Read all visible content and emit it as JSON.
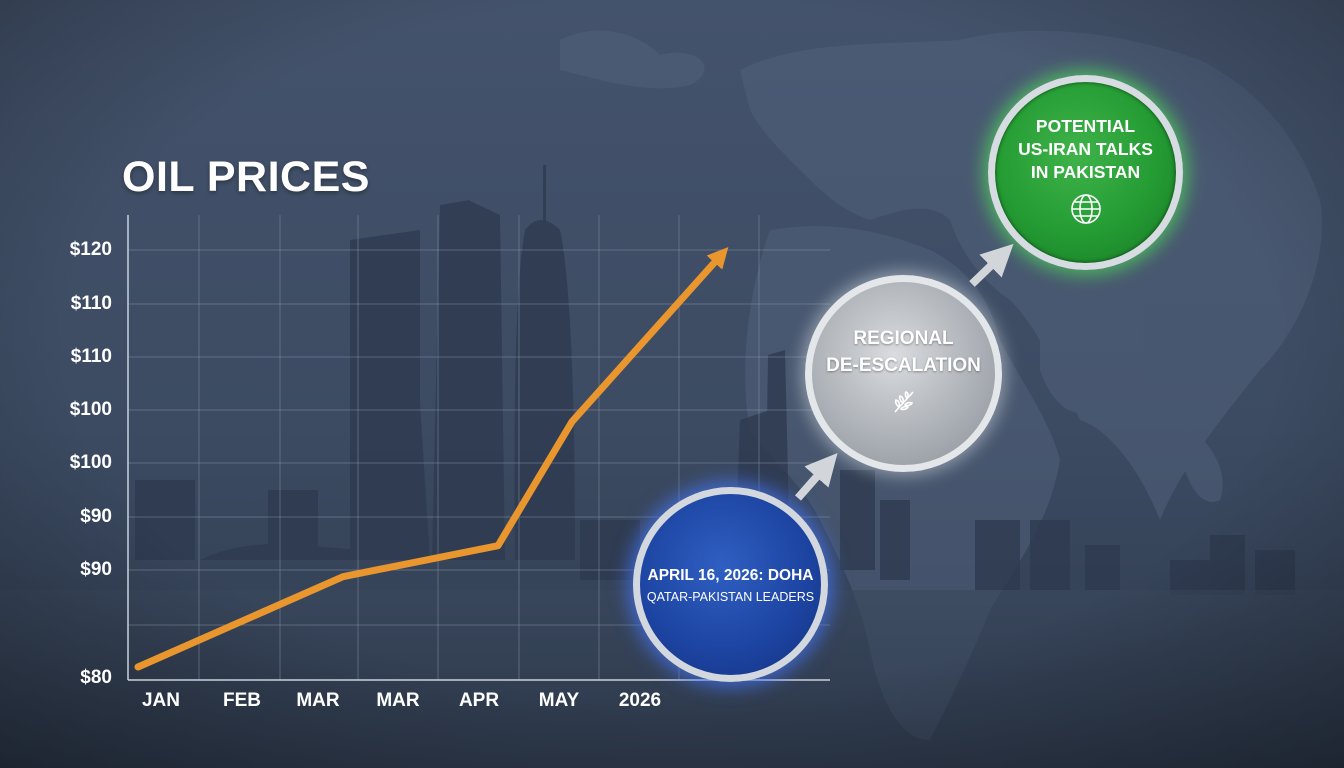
{
  "chart_data": {
    "type": "line",
    "title": "OIL PRICES",
    "categories": [
      "JAN",
      "FEB",
      "MAR",
      "MAR",
      "APR",
      "MAY",
      "2026"
    ],
    "y_tick_labels": [
      "$120",
      "$110",
      "$110",
      "$100",
      "$100",
      "$90",
      "$90",
      "$80"
    ],
    "ylim": [
      80,
      125
    ],
    "grid": true,
    "trend_arrow": true,
    "series": [
      {
        "color": "#e8962d",
        "points": [
          {
            "x": "JAN",
            "y": 80
          },
          {
            "x": "MAR",
            "y": 90
          },
          {
            "x": "APR",
            "y": 93
          },
          {
            "x": "MAY",
            "y": 105
          },
          {
            "x": "2026",
            "y": 121
          }
        ]
      }
    ]
  },
  "milestones": [
    {
      "line1": "APRIL 16, 2026: DOHA",
      "line2": "QATAR-PAKISTAN LEADERS",
      "color": "#1c43a0"
    },
    {
      "line1": "REGIONAL",
      "line2": "DE-ESCALATION",
      "icon": "olive-branch-icon",
      "color": "#a9aeb4"
    },
    {
      "line1": "POTENTIAL",
      "line2": "US-IRAN TALKS",
      "line3": "IN PAKISTAN",
      "icon": "globe-icon",
      "color": "#249b33"
    }
  ]
}
